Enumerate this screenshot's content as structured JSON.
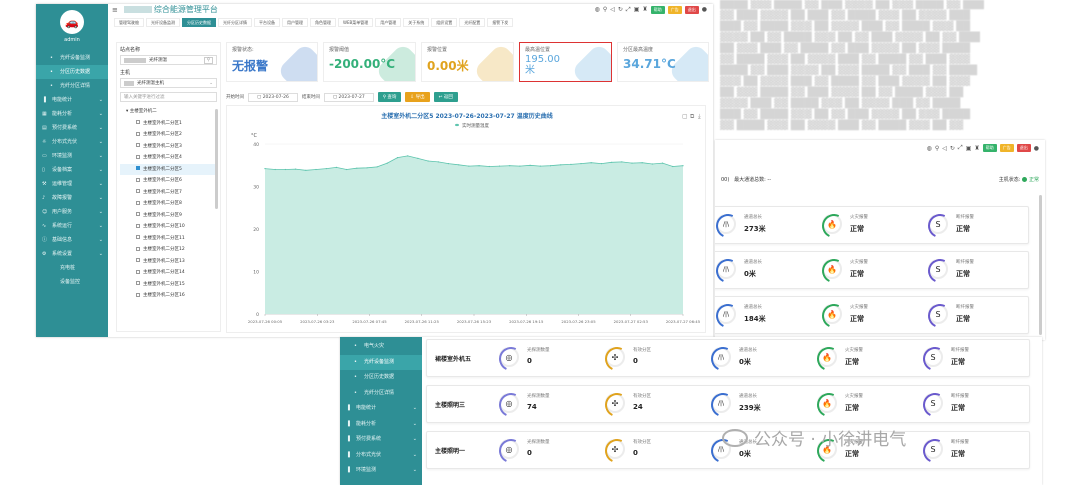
{
  "window1": {
    "sidebar": {
      "user": "admin",
      "items": [
        {
          "label": "光纤设备监测",
          "sub": true,
          "active": false,
          "icon": "dot"
        },
        {
          "label": "分区历史数据",
          "sub": true,
          "active": true,
          "icon": "dot"
        },
        {
          "label": "光纤分区详情",
          "sub": true,
          "active": false,
          "icon": "dot"
        },
        {
          "label": "电能统计",
          "sub": false,
          "active": false,
          "icon": "bar-chart-icon"
        },
        {
          "label": "能耗分析",
          "sub": false,
          "active": false,
          "icon": "grid-icon"
        },
        {
          "label": "预付费系统",
          "sub": false,
          "active": false,
          "icon": "wallet-icon"
        },
        {
          "label": "分布式光伏",
          "sub": false,
          "active": false,
          "icon": "sun-icon"
        },
        {
          "label": "环境监测",
          "sub": false,
          "active": false,
          "icon": "monitor-icon"
        },
        {
          "label": "设备档案",
          "sub": false,
          "active": false,
          "icon": "file-icon"
        },
        {
          "label": "运维管理",
          "sub": false,
          "active": false,
          "icon": "tool-icon"
        },
        {
          "label": "故障报警",
          "sub": false,
          "active": false,
          "icon": "bell-icon"
        },
        {
          "label": "用户服务",
          "sub": false,
          "active": false,
          "icon": "user-icon"
        },
        {
          "label": "系统运行",
          "sub": false,
          "active": false,
          "icon": "pulse-icon"
        },
        {
          "label": "基础信息",
          "sub": false,
          "active": false,
          "icon": "info-icon"
        },
        {
          "label": "系统设置",
          "sub": false,
          "active": false,
          "icon": "gear-icon"
        },
        {
          "label": "充电桩",
          "sub": true,
          "active": false,
          "icon": "none"
        },
        {
          "label": "设备监控",
          "sub": true,
          "active": false,
          "icon": "none"
        }
      ]
    },
    "topbar": {
      "title": "综合能源管理平台",
      "btn_green": "帮助",
      "btn_yellow": "广告",
      "btn_red": "退出"
    },
    "tabs": [
      "管理驾驶舱",
      "光纤设备监测",
      "分区历史数据",
      "光纤分区详情",
      "平台设备",
      "用户管理",
      "角色管理",
      "WEB菜单管理",
      "用户管理",
      "关于系统",
      "组织设置",
      "光纤配置",
      "报警下发"
    ],
    "tree": {
      "station_label": "站点名称",
      "station_value": "光纤测温",
      "host_label": "主机",
      "host_value": "光纤测温主机",
      "search_placeholder": "输入关键字进行过滤",
      "root": "主楼室外机二",
      "nodes": [
        "主楼室外机二分区1",
        "主楼室外机二分区2",
        "主楼室外机二分区3",
        "主楼室外机二分区4",
        "主楼室外机二分区5",
        "主楼室外机二分区6",
        "主楼室外机二分区7",
        "主楼室外机二分区8",
        "主楼室外机二分区9",
        "主楼室外机二分区10",
        "主楼室外机二分区11",
        "主楼室外机二分区12",
        "主楼室外机二分区13",
        "主楼室外机二分区14",
        "主楼室外机二分区15",
        "主楼室外机二分区16"
      ],
      "checked_index": 4
    },
    "cards": [
      {
        "label": "报警状态:",
        "value": "无报警",
        "color": "#3b78c9",
        "deco": "#3b78c9"
      },
      {
        "label": "报警阈值",
        "value": "-200.00°C",
        "color": "#34b07a",
        "deco": "#34b07a"
      },
      {
        "label": "报警位置",
        "value": "0.00米",
        "color": "#e0a31e",
        "deco": "#e0a31e"
      },
      {
        "label": "最高温位置",
        "value": "195.00米",
        "color": "#5aa6dc",
        "deco": "#5aa6dc"
      },
      {
        "label": "分区最高温度",
        "value": "34.71°C",
        "color": "#5aa6dc",
        "deco": "#5aa6dc"
      }
    ],
    "filter": {
      "start_label": "开始时间",
      "start_value": "2023-07-26",
      "end_label": "结束时间",
      "end_value": "2023-07-27",
      "query": "查询",
      "export": "导出",
      "back": "返回",
      "colors": {
        "query": "#2e9f8f",
        "export": "#e8a21c",
        "back": "#2e9f8f"
      }
    },
    "chart_data": {
      "type": "area",
      "title": "主楼室外机二分区5 2023-07-26-2023-07-27 温度历史曲线",
      "legend": [
        "实时测量温度"
      ],
      "ylabel": "°C",
      "ylim": [
        0,
        40
      ],
      "yticks": [
        0,
        10,
        20,
        30,
        40
      ],
      "xticklabels": [
        "2023-07-26 00:05",
        "2023-07-26 03:23",
        "2023-07-26 07:45",
        "2023-07-26 11:25",
        "2023-07-26 15:23",
        "2023-07-26 19:15",
        "2023-07-26 23:05",
        "2023-07-27 02:53",
        "2023-07-27 06:45"
      ],
      "series": [
        {
          "name": "实时测量温度",
          "values": [
            34.2,
            34.0,
            34.0,
            34.1,
            33.8,
            34.0,
            34.2,
            34.5,
            34.0,
            34.3,
            34.4,
            34.6,
            35.5,
            36.8,
            37.2,
            36.6,
            36.0,
            35.8,
            35.4,
            35.1,
            34.8,
            34.9,
            34.7,
            34.8,
            34.9,
            34.8,
            35.0,
            34.8,
            34.9,
            35.1,
            35.2,
            35.4,
            35.6,
            35.4,
            35.7,
            35.8,
            35.5,
            35.6,
            35.3,
            35.5,
            34.7,
            34.9
          ]
        }
      ],
      "color": "#5cc4ad",
      "fill": "#c9ece3",
      "grid": true,
      "legend_position": "top-center"
    }
  },
  "window2": {
    "btn_green": "帮助",
    "btn_yellow": "广告",
    "btn_red": "退出",
    "header_left_prefix": "00)",
    "header_left": "最大通道总数: --",
    "header_right_label": "主机状态:",
    "header_right_value": "正常",
    "rows": [
      {
        "cells": [
          {
            "k": "通道总长",
            "v": "273米"
          },
          {
            "k": "火灾报警",
            "v": "正常"
          },
          {
            "k": "断纤报警",
            "v": "正常"
          }
        ]
      },
      {
        "cells": [
          {
            "k": "通道总长",
            "v": "0米"
          },
          {
            "k": "火灾报警",
            "v": "正常"
          },
          {
            "k": "断纤报警",
            "v": "正常"
          }
        ]
      },
      {
        "cells": [
          {
            "k": "通道总长",
            "v": "184米"
          },
          {
            "k": "火灾报警",
            "v": "正常"
          },
          {
            "k": "断纤报警",
            "v": "正常"
          }
        ]
      }
    ]
  },
  "window3": {
    "sidebar": [
      {
        "label": "电气火灾",
        "sub": true,
        "active": false
      },
      {
        "label": "光纤设备监测",
        "sub": true,
        "active": true
      },
      {
        "label": "分区历史数据",
        "sub": true,
        "active": false
      },
      {
        "label": "光纤分区详情",
        "sub": true,
        "active": false
      },
      {
        "label": "电能统计",
        "sub": false,
        "active": false
      },
      {
        "label": "能耗分析",
        "sub": false,
        "active": false
      },
      {
        "label": "预付费系统",
        "sub": false,
        "active": false
      },
      {
        "label": "分布式光伏",
        "sub": false,
        "active": false
      },
      {
        "label": "环境监测",
        "sub": false,
        "active": false
      }
    ],
    "rows": [
      {
        "name": "裙楼室外机五",
        "cells": [
          {
            "k": "光探测数量",
            "v": "0"
          },
          {
            "k": "有效分区",
            "v": "0"
          },
          {
            "k": "通道总长",
            "v": "0米"
          },
          {
            "k": "火灾报警",
            "v": "正常"
          },
          {
            "k": "断纤报警",
            "v": "正常"
          }
        ]
      },
      {
        "name": "主楼照明三",
        "cells": [
          {
            "k": "光探测数量",
            "v": "74"
          },
          {
            "k": "有效分区",
            "v": "24"
          },
          {
            "k": "通道总长",
            "v": "239米"
          },
          {
            "k": "火灾报警",
            "v": "正常"
          },
          {
            "k": "断纤报警",
            "v": "正常"
          }
        ]
      },
      {
        "name": "主楼照明一",
        "cells": [
          {
            "k": "光探测数量",
            "v": "0"
          },
          {
            "k": "有效分区",
            "v": "0"
          },
          {
            "k": "通道总长",
            "v": "0米"
          },
          {
            "k": "火灾报警",
            "v": "正常"
          },
          {
            "k": "断纤报警",
            "v": "正常"
          }
        ]
      }
    ]
  },
  "watermark": "公众号 · 小徐讲电气"
}
